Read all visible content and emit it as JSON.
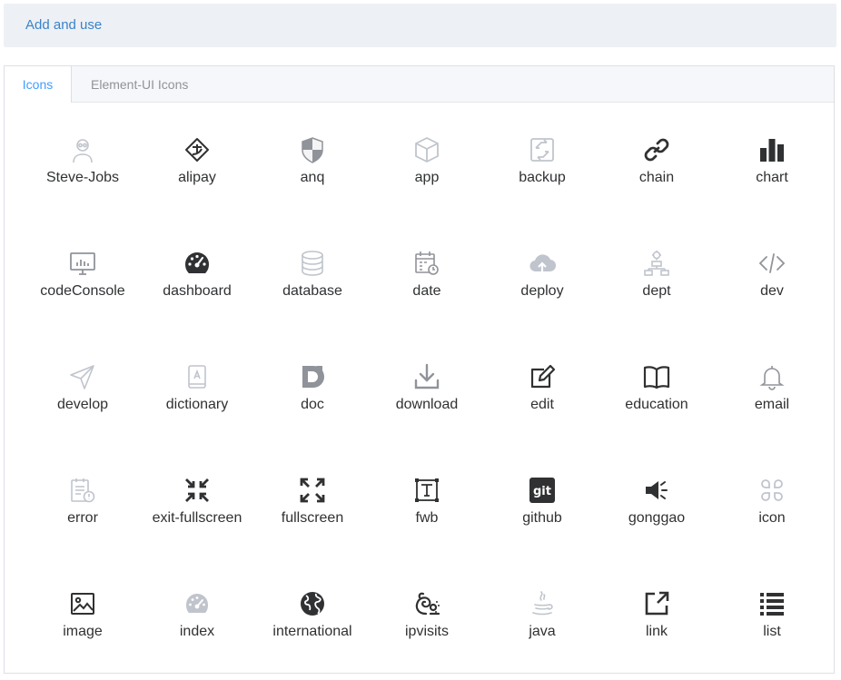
{
  "header": {
    "link_label": "Add and use"
  },
  "tabs": [
    {
      "label": "Icons"
    },
    {
      "label": "Element-UI Icons"
    }
  ],
  "colors": {
    "accent": "#409eff",
    "dark": "#303133",
    "light": "#c0c4cc"
  },
  "icons": [
    {
      "label": "Steve-Jobs",
      "icon": "steve-jobs-icon"
    },
    {
      "label": "alipay",
      "icon": "alipay-icon"
    },
    {
      "label": "anq",
      "icon": "shield-icon"
    },
    {
      "label": "app",
      "icon": "box-icon"
    },
    {
      "label": "backup",
      "icon": "backup-icon"
    },
    {
      "label": "chain",
      "icon": "chain-icon"
    },
    {
      "label": "chart",
      "icon": "chart-icon"
    },
    {
      "label": "codeConsole",
      "icon": "monitor-icon"
    },
    {
      "label": "dashboard",
      "icon": "gauge-icon"
    },
    {
      "label": "database",
      "icon": "database-icon"
    },
    {
      "label": "date",
      "icon": "calendar-clock-icon"
    },
    {
      "label": "deploy",
      "icon": "cloud-upload-icon"
    },
    {
      "label": "dept",
      "icon": "org-chart-icon"
    },
    {
      "label": "dev",
      "icon": "code-icon"
    },
    {
      "label": "develop",
      "icon": "send-icon"
    },
    {
      "label": "dictionary",
      "icon": "dictionary-icon"
    },
    {
      "label": "doc",
      "icon": "doc-icon"
    },
    {
      "label": "download",
      "icon": "download-icon"
    },
    {
      "label": "edit",
      "icon": "edit-icon"
    },
    {
      "label": "education",
      "icon": "book-icon"
    },
    {
      "label": "email",
      "icon": "bell-icon"
    },
    {
      "label": "error",
      "icon": "error-doc-icon"
    },
    {
      "label": "exit-fullscreen",
      "icon": "exit-fullscreen-icon"
    },
    {
      "label": "fullscreen",
      "icon": "fullscreen-icon"
    },
    {
      "label": "fwb",
      "icon": "text-box-icon"
    },
    {
      "label": "github",
      "icon": "github-icon"
    },
    {
      "label": "gonggao",
      "icon": "megaphone-icon"
    },
    {
      "label": "icon",
      "icon": "grid-circles-icon"
    },
    {
      "label": "image",
      "icon": "image-icon"
    },
    {
      "label": "index",
      "icon": "speedometer-icon"
    },
    {
      "label": "international",
      "icon": "globe-icon"
    },
    {
      "label": "ipvisits",
      "icon": "ipvisits-icon"
    },
    {
      "label": "java",
      "icon": "java-icon"
    },
    {
      "label": "link",
      "icon": "external-link-icon"
    },
    {
      "label": "list",
      "icon": "list-icon"
    }
  ]
}
